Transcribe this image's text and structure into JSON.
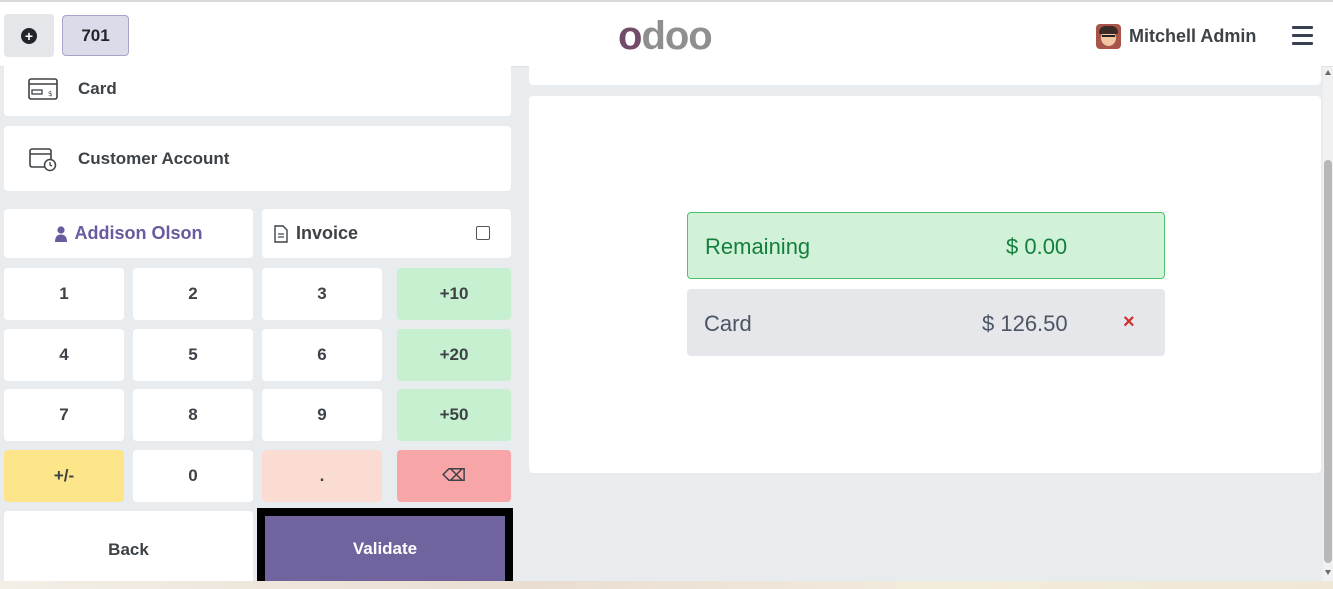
{
  "header": {
    "new_order_icon": "plus-circle-icon",
    "table_number": "701",
    "logo": {
      "first": "o",
      "rest": "doo"
    },
    "user_name": "Mitchell Admin",
    "menu_icon": "hamburger-icon"
  },
  "payment_methods": [
    {
      "label": "Card",
      "icon": "card-icon"
    },
    {
      "label": "Customer Account",
      "icon": "customer-account-icon"
    }
  ],
  "customer": {
    "name": "Addison Olson",
    "icon": "person-icon"
  },
  "invoice": {
    "label": "Invoice",
    "icon": "document-icon",
    "checked": false
  },
  "keypad": {
    "k1": "1",
    "k2": "2",
    "k3": "3",
    "p10": "+10",
    "k4": "4",
    "k5": "5",
    "k6": "6",
    "p20": "+20",
    "k7": "7",
    "k8": "8",
    "k9": "9",
    "p50": "+50",
    "sign": "+/-",
    "k0": "0",
    "dot": ".",
    "backspace": "⌫"
  },
  "actions": {
    "back": "Back",
    "validate": "Validate"
  },
  "summary": {
    "remaining_label": "Remaining",
    "remaining_value": "$ 0.00",
    "lines": [
      {
        "method": "Card",
        "amount": "$ 126.50",
        "remove": "×"
      }
    ]
  },
  "colors": {
    "brand": "#714b67",
    "validate": "#71639e",
    "quick_add": "#c7f0d0",
    "remaining_bg": "#d1f1d9",
    "remaining_text": "#15803d",
    "backspace": "#f8a5a8",
    "sign": "#fde68a"
  }
}
